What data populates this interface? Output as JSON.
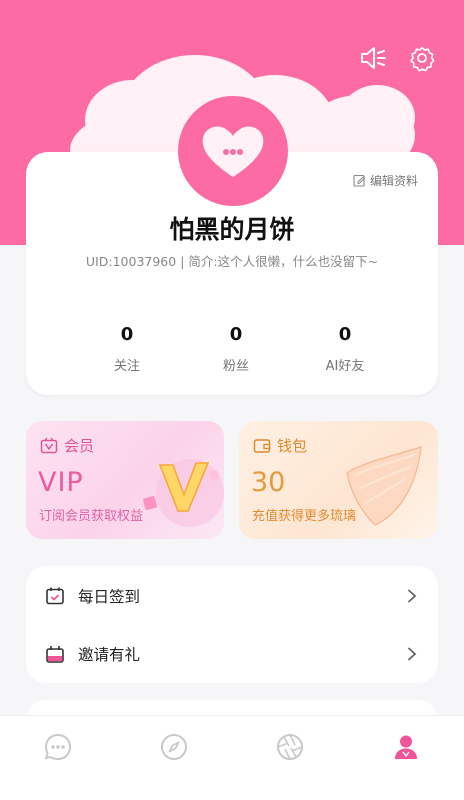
{
  "header": {
    "background_color": "#fd6ba5",
    "icons": [
      "speaker-icon",
      "settings-gear-icon"
    ]
  },
  "profile": {
    "edit_label": "编辑资料",
    "nickname": "怕黑的月饼",
    "uid_line": "UID:10037960 | 简介:这个人很懒，什么也没留下~",
    "avatar_icon": "chat-heart-icon",
    "stats": [
      {
        "value": "0",
        "label": "关注"
      },
      {
        "value": "0",
        "label": "粉丝"
      },
      {
        "value": "0",
        "label": "AI好友"
      }
    ]
  },
  "vip": {
    "title": "会员",
    "headline": "VIP",
    "subtitle": "订阅会员获取权益",
    "accent": "#ef5a9f"
  },
  "wallet": {
    "title": "钱包",
    "amount": "30",
    "subtitle": "充值获得更多琉璃",
    "accent": "#e59a3e"
  },
  "menu": [
    {
      "label": "每日签到",
      "icon": "calendar-check-icon"
    },
    {
      "label": "邀请有礼",
      "icon": "gift-calendar-icon"
    }
  ],
  "tabbar": {
    "tabs": [
      "chat-tab",
      "discover-tab",
      "explore-tab",
      "profile-tab"
    ],
    "active": 3,
    "active_color": "#f0559a",
    "inactive_color": "#c9c9c9"
  }
}
